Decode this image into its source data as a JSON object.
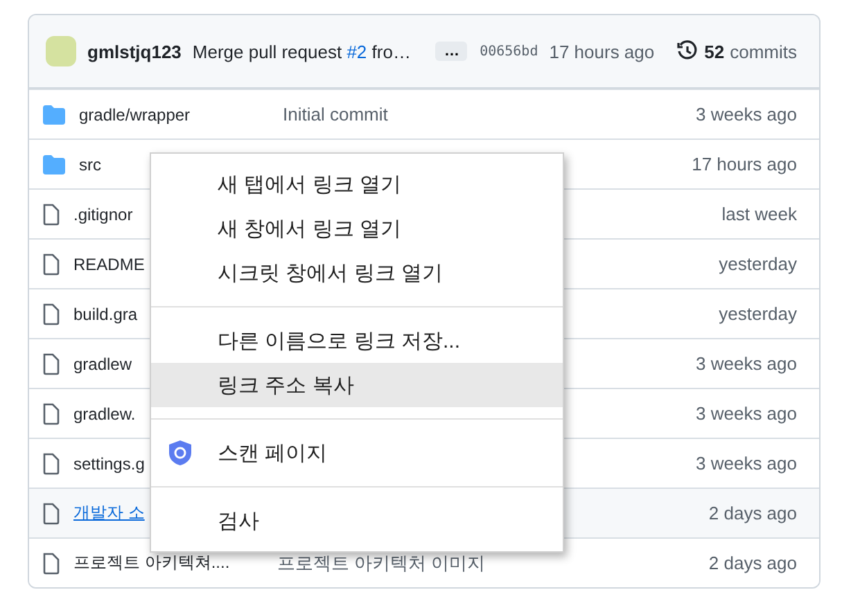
{
  "latest_commit": {
    "author": "gmlstjq123",
    "message_before": "Merge pull request ",
    "issue": "#2",
    "message_after": " fro…",
    "more": "…",
    "sha": "00656bd",
    "time": "17 hours ago",
    "commit_count": "52",
    "commit_label": "commits"
  },
  "files": [
    {
      "kind": "folder",
      "name": "gradle/wrapper",
      "message": "Initial commit",
      "time": "3 weeks ago",
      "hovered": false
    },
    {
      "kind": "folder",
      "name": "src",
      "time": "17 hours ago",
      "hovered": false
    },
    {
      "kind": "file",
      "name": ".gitignor",
      "time": "last week",
      "hovered": false
    },
    {
      "kind": "file",
      "name": "README",
      "time": "yesterday",
      "hovered": false
    },
    {
      "kind": "file",
      "name": "build.gra",
      "time": "yesterday",
      "hovered": false
    },
    {
      "kind": "file",
      "name": "gradlew",
      "time": "3 weeks ago",
      "hovered": false
    },
    {
      "kind": "file",
      "name": "gradlew.",
      "time": "3 weeks ago",
      "hovered": false
    },
    {
      "kind": "file",
      "name": "settings.g",
      "time": "3 weeks ago",
      "hovered": false
    },
    {
      "kind": "file",
      "name": "개발자 소",
      "time": "2 days ago",
      "hovered": true
    },
    {
      "kind": "file",
      "name": "프로젝트 아키텍쳐....",
      "message": "프로젝트 아키텍처 이미지",
      "time": "2 days ago",
      "hovered": false
    }
  ],
  "context_menu": {
    "groups": [
      [
        {
          "label": "새 탭에서 링크 열기",
          "selected": false
        },
        {
          "label": "새 창에서 링크 열기",
          "selected": false
        },
        {
          "label": "시크릿 창에서 링크 열기",
          "selected": false
        }
      ],
      [
        {
          "label": "다른 이름으로 링크 저장...",
          "selected": false
        },
        {
          "label": "링크 주소 복사",
          "selected": true
        }
      ],
      [
        {
          "label": "스캔 페이지",
          "selected": false,
          "kind": "extension"
        }
      ],
      [
        {
          "label": "검사",
          "selected": false
        }
      ]
    ]
  }
}
